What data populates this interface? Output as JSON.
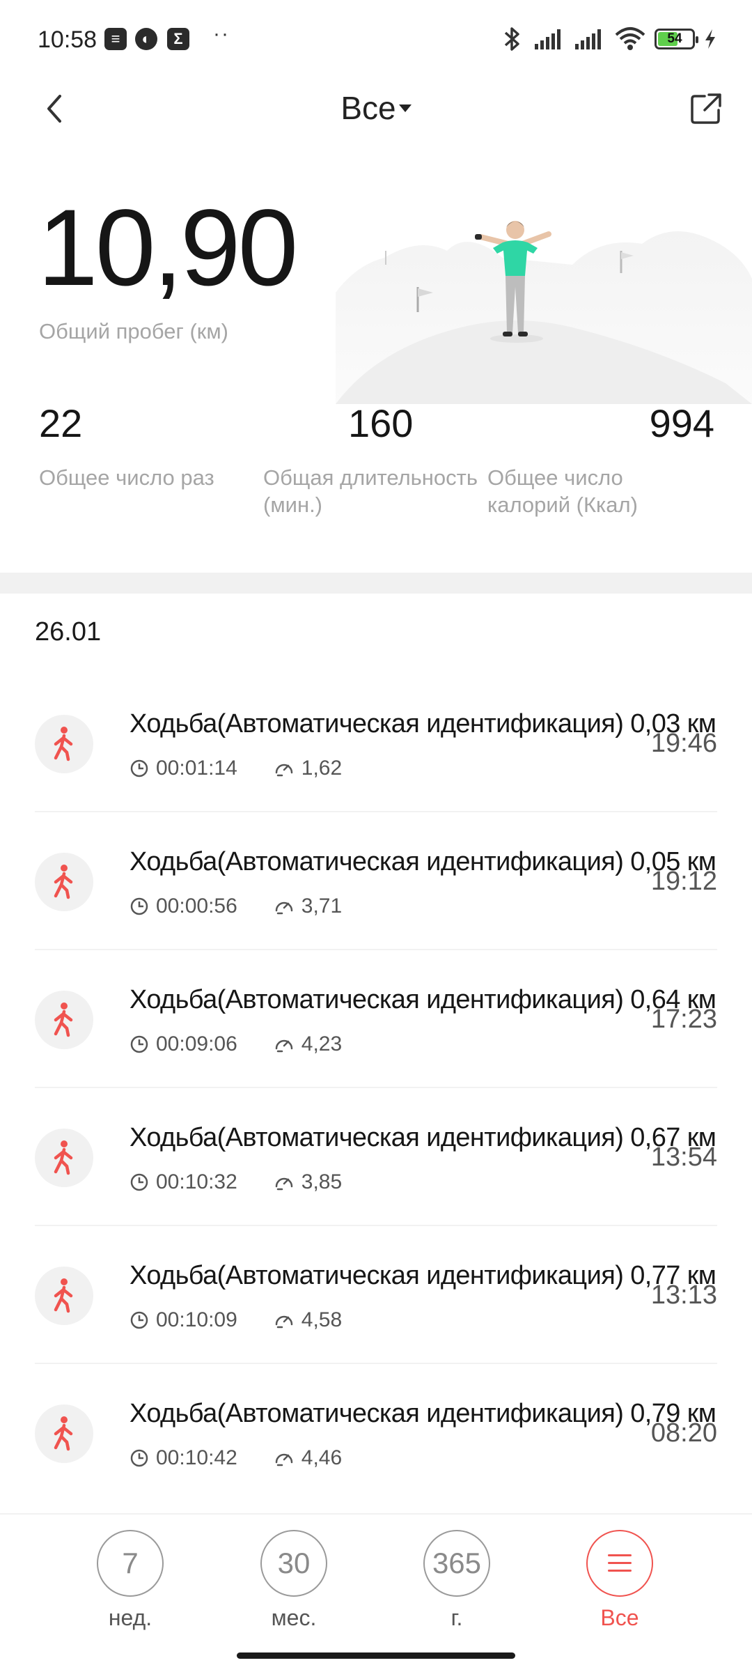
{
  "status_bar": {
    "time": "10:58",
    "battery_level": "54",
    "battery_fraction": 0.54,
    "icons": [
      "notification-icon",
      "app-icon",
      "sigma-icon",
      "bluetooth-icon",
      "signal-icon",
      "signal-icon",
      "wifi-icon",
      "battery-icon",
      "charging-icon"
    ]
  },
  "header": {
    "title": "Все",
    "back_icon": "chevron-left-icon",
    "share_icon": "share-icon"
  },
  "summary": {
    "total_distance": "10,90",
    "total_distance_label": "Общий пробег (км)",
    "stats": [
      {
        "value": "22",
        "label": "Общее число раз"
      },
      {
        "value": "160",
        "label": "Общая длительность (мин.)"
      },
      {
        "value": "994",
        "label": "Общее число калорий (Ккал)"
      }
    ]
  },
  "section": {
    "date": "26.01"
  },
  "activities": [
    {
      "title": "Ходьба(Автоматическая идентификация)",
      "distance": "0,03 км",
      "duration": "00:01:14",
      "speed": "1,62",
      "time": "19:46"
    },
    {
      "title": "Ходьба(Автоматическая идентификация)",
      "distance": "0,05 км",
      "duration": "00:00:56",
      "speed": "3,71",
      "time": "19:12"
    },
    {
      "title": "Ходьба(Автоматическая идентификация)",
      "distance": "0,64 км",
      "duration": "00:09:06",
      "speed": "4,23",
      "time": "17:23"
    },
    {
      "title": "Ходьба(Автоматическая идентификация)",
      "distance": "0,67 км",
      "duration": "00:10:32",
      "speed": "3,85",
      "time": "13:54"
    },
    {
      "title": "Ходьба(Автоматическая идентификация)",
      "distance": "0,77 км",
      "duration": "00:10:09",
      "speed": "4,58",
      "time": "13:13"
    },
    {
      "title": "Ходьба(Автоматическая идентификация)",
      "distance": "0,79 км",
      "duration": "00:10:42",
      "speed": "4,46",
      "time": "08:20"
    }
  ],
  "bottom_nav": {
    "items": [
      {
        "circle": "7",
        "label": "нед."
      },
      {
        "circle": "30",
        "label": "мес."
      },
      {
        "circle": "365",
        "label": "г."
      },
      {
        "circle": "",
        "label": "Все",
        "active": true
      }
    ]
  },
  "colors": {
    "accent": "#f0534f",
    "walk_icon": "#f0534f",
    "text_primary": "#161616",
    "text_secondary": "#a5a5a5",
    "battery": "#5fcf4c",
    "shirt": "#2fd6a5"
  }
}
